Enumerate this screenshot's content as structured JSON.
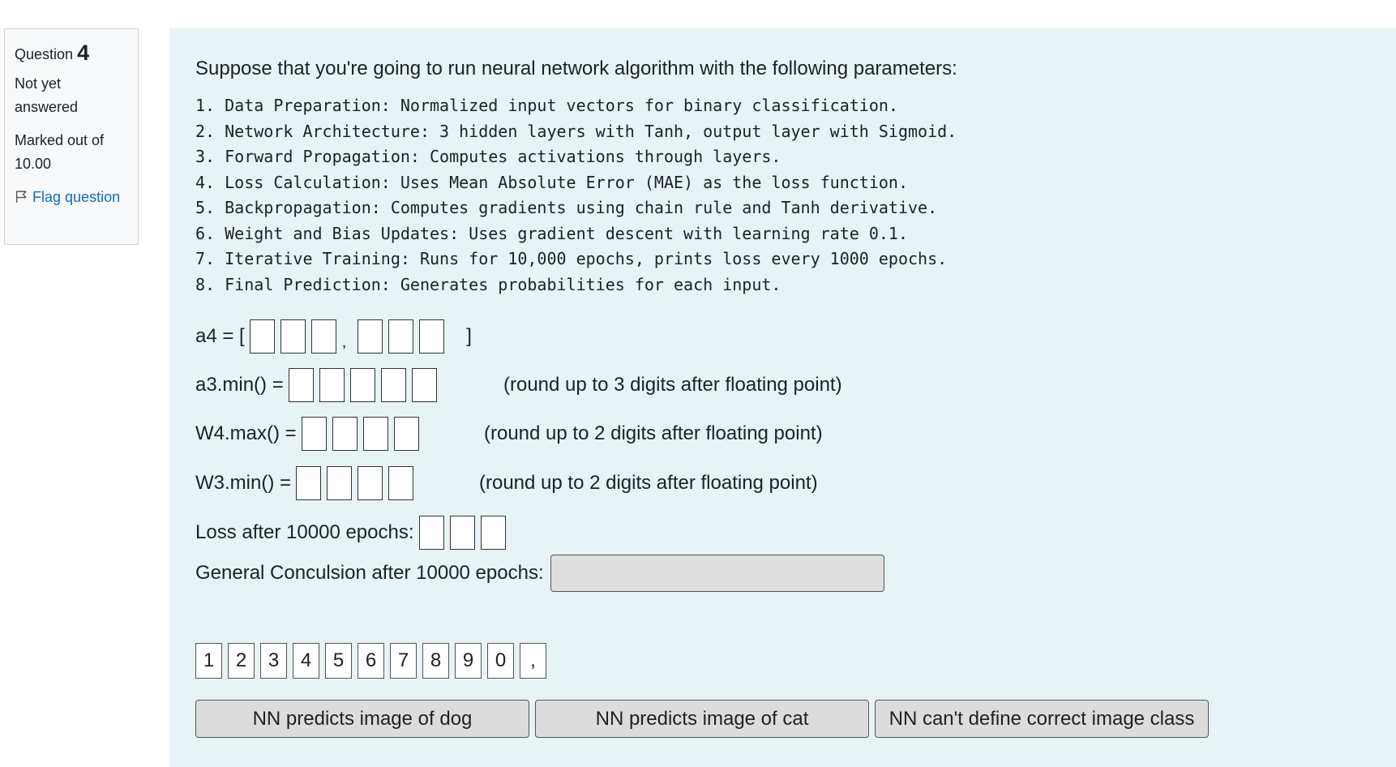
{
  "info": {
    "question_label": "Question",
    "question_number": "4",
    "state": "Not yet answered",
    "grade": "Marked out of 10.00",
    "flag": "Flag question"
  },
  "question": {
    "prompt": "Suppose that you're going to run neural network algorithm with the following parameters:",
    "steps": [
      "1. Data Preparation: Normalized input vectors for binary classification.",
      "2. Network Architecture: 3 hidden layers with Tanh, output layer with Sigmoid.",
      "3. Forward Propagation: Computes activations through layers.",
      "4. Loss Calculation: Uses Mean Absolute Error (MAE) as the loss function.",
      "5. Backpropagation: Computes gradients using chain rule and Tanh derivative.",
      "6. Weight and Bias Updates: Uses gradient descent with learning rate 0.1.",
      "7. Iterative Training: Runs for 10,000 epochs, prints loss every 1000 epochs.",
      "8. Final Prediction: Generates probabilities for each input."
    ]
  },
  "rows": {
    "a4": {
      "label": "a4 = [",
      "separator": ",",
      "close": "]"
    },
    "a3": {
      "label": "a3.min() =",
      "hint": "(round up to  3 digits after floating point)"
    },
    "w4": {
      "label": "W4.max() =",
      "hint": "(round up to  2 digits after floating point)"
    },
    "w3": {
      "label": "W3.min() =",
      "hint": "(round up to  2 digits after floating point)"
    },
    "loss": {
      "label": "Loss after 10000 epochs:"
    },
    "conclusion": {
      "label": "General Conculsion after 10000 epochs:"
    }
  },
  "tokens": [
    "1",
    "2",
    "3",
    "4",
    "5",
    "6",
    "7",
    "8",
    "9",
    "0",
    ","
  ],
  "choices": [
    "NN predicts image of dog",
    "NN predicts image of cat",
    "NN can't define correct image class"
  ]
}
